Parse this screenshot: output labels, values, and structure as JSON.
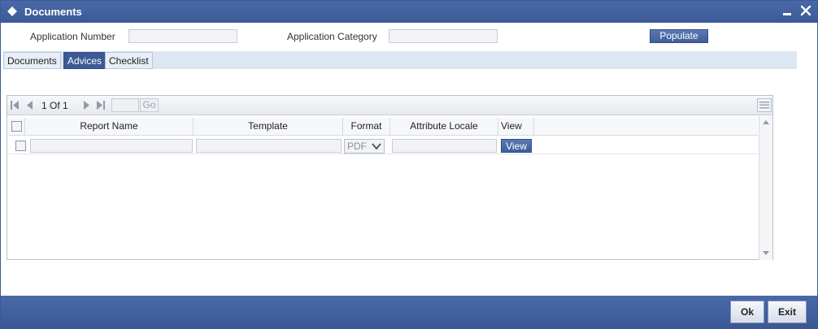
{
  "window": {
    "title": "Documents"
  },
  "form": {
    "application_number_label": "Application Number",
    "application_number_value": "",
    "application_category_label": "Application Category",
    "application_category_value": "",
    "populate_label": "Populate"
  },
  "tabs": [
    {
      "label": "Documents",
      "active": false
    },
    {
      "label": "Advices",
      "active": true
    },
    {
      "label": "Checklist",
      "active": false
    }
  ],
  "grid": {
    "pager": {
      "current": "1",
      "of_label": "Of",
      "total": "1",
      "go_label": "Go"
    },
    "columns": [
      "Report Name",
      "Template",
      "Format",
      "Attribute Locale",
      "View"
    ],
    "rows": [
      {
        "report_name": "",
        "template": "",
        "format": "PDF",
        "attribute_locale": "",
        "view_label": "View"
      }
    ]
  },
  "footer": {
    "ok_label": "Ok",
    "exit_label": "Exit"
  },
  "colors": {
    "brand": "#3c5a96",
    "tabstrip": "#dde6f3"
  }
}
